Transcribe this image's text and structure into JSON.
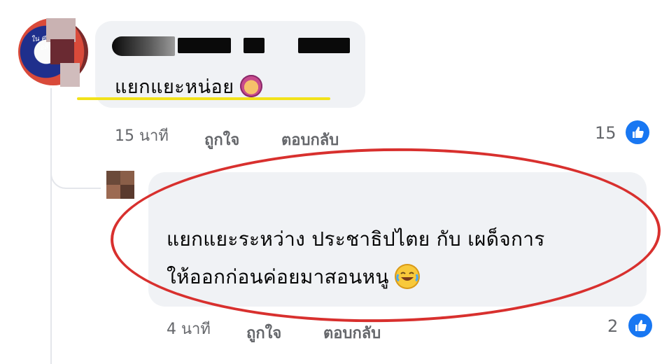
{
  "comment": {
    "author_redacted": "",
    "text": "แยกแยะหน่อย",
    "emoji": "person-gesturing-ok-emoji",
    "time": "15 นาที",
    "like_label": "ถูกใจ",
    "reply_label": "ตอบกลับ",
    "reaction_count": "15",
    "avatar_text": "ใน ศาลน อสิบ"
  },
  "reply": {
    "line1": "แยกแยะระหว่าง ประชาธิปไตย กับ เผด็จการ",
    "line2": "ให้ออกก่อนค่อยมาสอนหนู",
    "emoji": "face-with-tears-of-joy-emoji",
    "time": "4 นาที",
    "like_label": "ถูกใจ",
    "reply_label": "ตอบกลับ",
    "reaction_count": "2"
  },
  "colors": {
    "bubble": "#f0f2f5",
    "meta_text": "#65676b",
    "like_blue": "#1877f2",
    "annotation_red": "#d8302e",
    "annotation_yellow": "#f2e21a"
  }
}
